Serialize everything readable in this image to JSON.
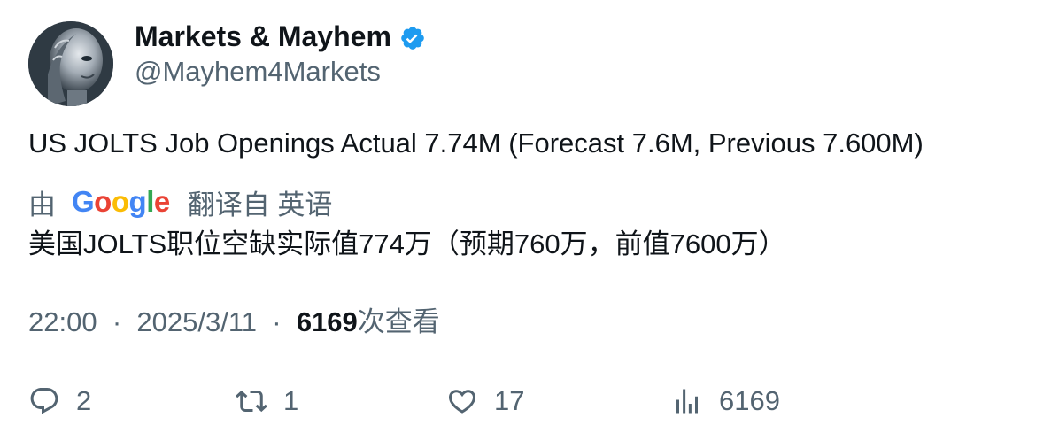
{
  "author": {
    "name": "Markets & Mayhem",
    "handle": "@Mayhem4Markets",
    "verified_color": "#1d9bf0"
  },
  "tweet": {
    "text": "US JOLTS Job Openings Actual 7.74M (Forecast 7.6M, Previous 7.600M)"
  },
  "translation": {
    "prefix": "由",
    "provider": "Google",
    "suffix": "翻译自 英语",
    "text": "美国JOLTS职位空缺实际值774万（预期760万，前值7600万）"
  },
  "meta": {
    "time": "22:00",
    "separator": "·",
    "date": "2025/3/11",
    "views_count": "6169",
    "views_label": "次查看"
  },
  "actions": {
    "reply_count": "2",
    "retweet_count": "1",
    "like_count": "17",
    "views_count": "6169"
  },
  "icons": {
    "verified": "verified-badge-icon",
    "reply": "reply-icon",
    "retweet": "retweet-icon",
    "like": "heart-icon",
    "views": "bar-chart-icon"
  },
  "colors": {
    "text_primary": "#0f1419",
    "text_secondary": "#536471",
    "google_blue": "#4285F4",
    "google_red": "#EA4335",
    "google_yellow": "#FBBC05",
    "google_green": "#34A853"
  }
}
